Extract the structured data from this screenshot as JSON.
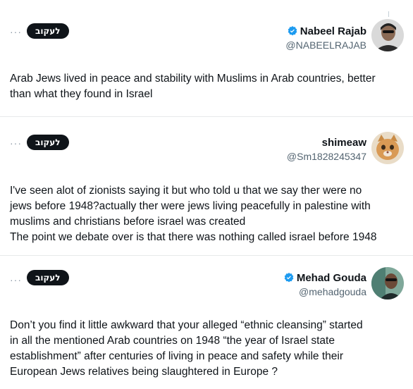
{
  "posts": [
    {
      "name": "Nabeel Rajab",
      "handle": "@NABEELRAJAB",
      "verified": true,
      "follow_label": "לעקוב",
      "more_label": "···",
      "lines": [
        "Arab Jews lived in peace and stability with Muslims in Arab countries, better",
        "than what they found in Israel"
      ]
    },
    {
      "name": "shimeaw",
      "handle": "@Sm1828245347",
      "verified": false,
      "follow_label": "לעקוב",
      "more_label": "···",
      "lines": [
        "I've seen alot of zionists saying it but who told u that we say ther were no",
        "jews before 1948?actually ther were jews living peacefully in palestine with",
        "muslims and christians before israel was created",
        "The point we debate over is that there was nothing called israel before 1948"
      ]
    },
    {
      "name": "Mehad Gouda",
      "handle": "@mehadgouda",
      "verified": true,
      "follow_label": "לעקוב",
      "more_label": "···",
      "lines": [
        "Don’t you find it little awkward that your alleged “ethnic cleansing” started",
        "in all the mentioned Arab countries on 1948 “the year of Israel state",
        "establishment” after centuries of living in peace and safety while their",
        "European Jews relatives being slaughtered in Europe ?"
      ]
    }
  ],
  "colors": {
    "verified_badge": "#1d9bf0",
    "follow_button": "#0f1419",
    "handle": "#536471"
  }
}
